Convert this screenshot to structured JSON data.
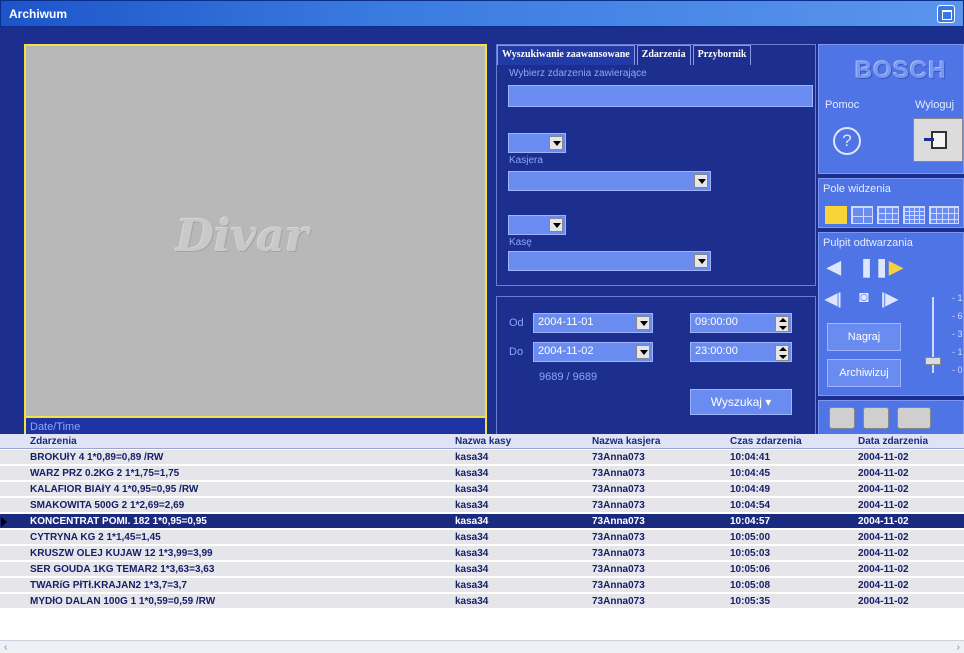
{
  "window": {
    "title": "Archiwum"
  },
  "video": {
    "logo": "Divar",
    "datetime_label": "Date/Time"
  },
  "search": {
    "tabs": [
      "Wyszukiwanie zaawansowane",
      "Zdarzenia",
      "Przybornik"
    ],
    "events_label": "Wybierz zdarzenia zawierające",
    "events_value": "",
    "cashier_op": "",
    "cashier_label": "Kasjera",
    "cashier_value": "",
    "register_op": "",
    "register_label": "Kasę",
    "register_value": ""
  },
  "dates": {
    "from_label": "Od",
    "from_date": "2004-11-01",
    "from_time": "09:00:00",
    "to_label": "Do",
    "to_date": "2004-11-02",
    "to_time": "23:00:00",
    "count": "9689 / 9689",
    "search_button": "Wyszukaj ▾"
  },
  "right": {
    "brand": "BOSCH",
    "help_label": "Pomoc",
    "logout_label": "Wyloguj",
    "fov_label": "Pole widzenia",
    "playback_label": "Pulpit odtwarzania",
    "record_button": "Nagraj",
    "archive_button": "Archiwizuj",
    "speed_ticks": [
      "- 1",
      "- 6",
      "- 3",
      "- 1",
      "- 0"
    ]
  },
  "table": {
    "columns": [
      "Zdarzenia",
      "Nazwa kasy",
      "Nazwa kasjera",
      "Czas zdarzenia",
      "Data zdarzenia"
    ],
    "selected_index": 4,
    "rows": [
      [
        "BROKUłY        4  1*0,89=0,89 /RW",
        "kasa34",
        "73Anna073",
        "10:04:41",
        "2004-11-02"
      ],
      [
        "WARZ PRZ 0.2KG    2  1*1,75=1,75",
        "kasa34",
        "73Anna073",
        "10:04:45",
        "2004-11-02"
      ],
      [
        "KALAFIOR BIAłY    4  1*0,95=0,95 /RW",
        "kasa34",
        "73Anna073",
        "10:04:49",
        "2004-11-02"
      ],
      [
        "SMAKOWITA 500G    2  1*2,69=2,69",
        "kasa34",
        "73Anna073",
        "10:04:54",
        "2004-11-02"
      ],
      [
        "KONCENTRAT POMI. 182  1*0,95=0,95",
        "kasa34",
        "73Anna073",
        "10:04:57",
        "2004-11-02"
      ],
      [
        "CYTRYNA KG        2  1*1,45=1,45",
        "kasa34",
        "73Anna073",
        "10:05:00",
        "2004-11-02"
      ],
      [
        "KRUSZW OLEJ KUJAW 12  1*3,99=3,99",
        "kasa34",
        "73Anna073",
        "10:05:03",
        "2004-11-02"
      ],
      [
        "SER GOUDA 1KG TEMAR2  1*3,63=3,63",
        "kasa34",
        "73Anna073",
        "10:05:06",
        "2004-11-02"
      ],
      [
        "TWARíG PłTł.KRAJAN2  1*3,7=3,7",
        "kasa34",
        "73Anna073",
        "10:05:08",
        "2004-11-02"
      ],
      [
        "MYDłO DALAN 100G   1  1*0,59=0,59 /RW",
        "kasa34",
        "73Anna073",
        "10:05:35",
        "2004-11-02"
      ]
    ]
  }
}
